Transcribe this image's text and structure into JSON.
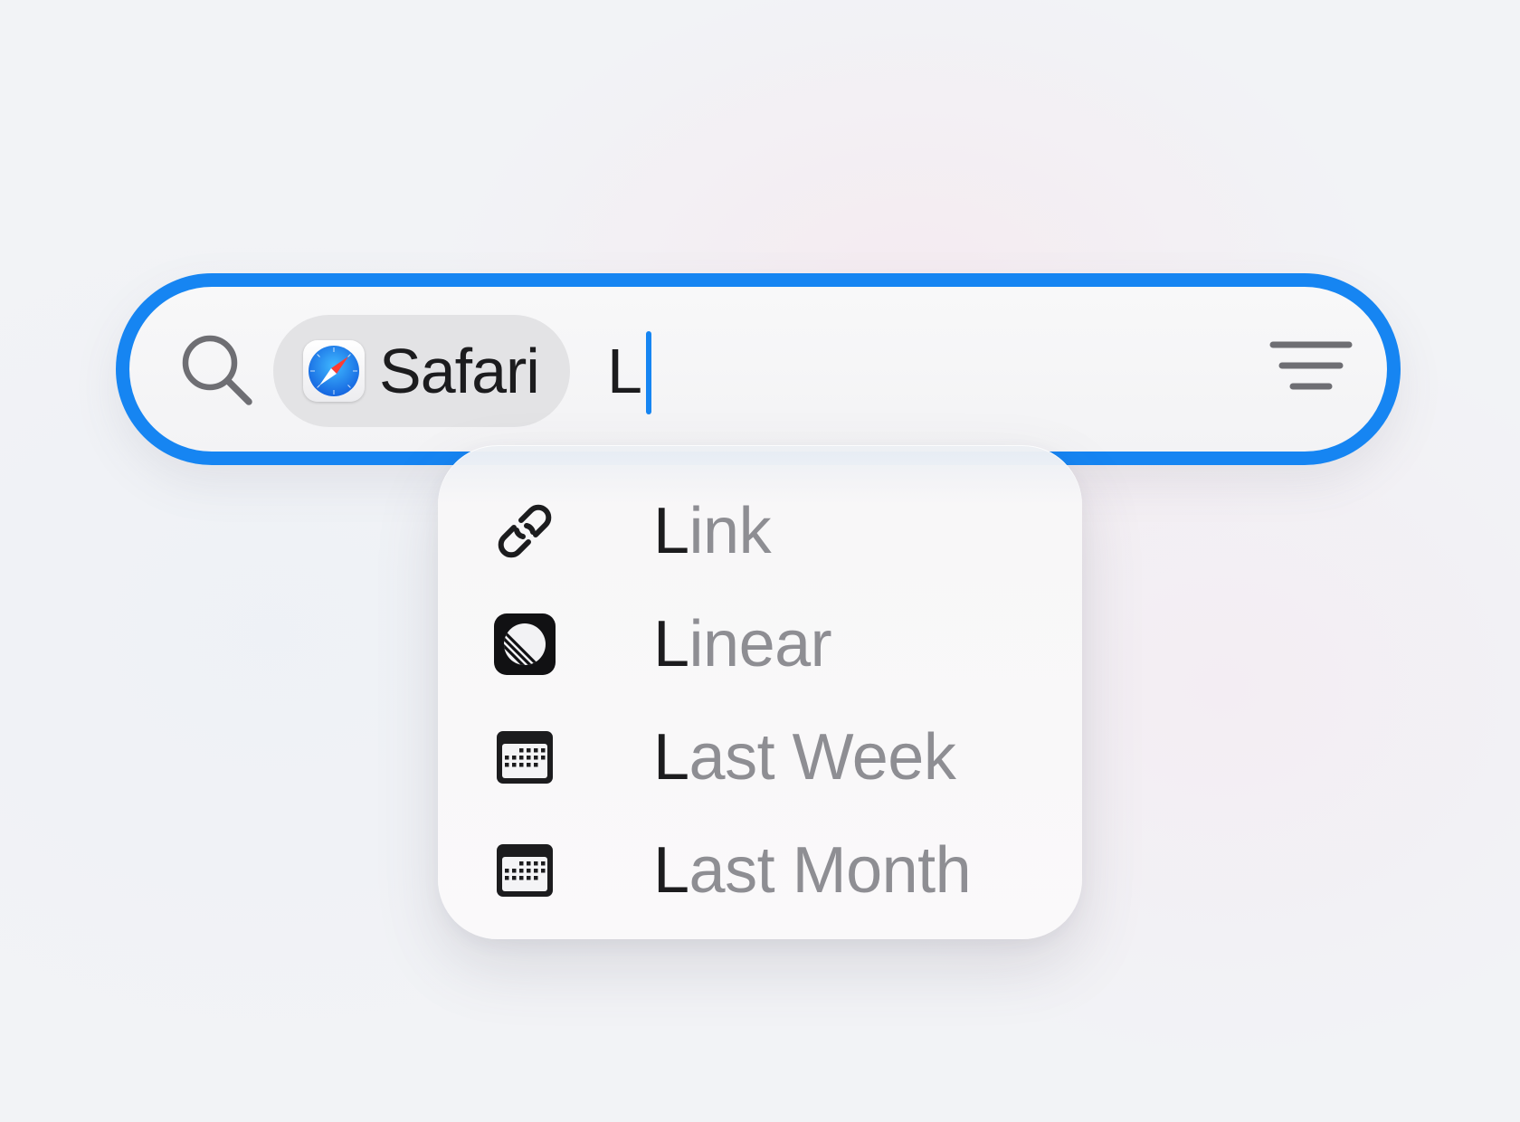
{
  "search": {
    "scope_label": "Safari",
    "query": "L",
    "accent_color": "#1685f2"
  },
  "icons": {
    "search": "magnifying-glass",
    "scope": "safari-compass",
    "filter": "filter-lines"
  },
  "suggestions": [
    {
      "match": "L",
      "rest": "ink",
      "icon": "link-icon"
    },
    {
      "match": "L",
      "rest": "inear",
      "icon": "linear-app-icon"
    },
    {
      "match": "L",
      "rest": "ast Week",
      "icon": "calendar-icon"
    },
    {
      "match": "L",
      "rest": "ast Month",
      "icon": "calendar-icon"
    }
  ],
  "colors": {
    "matched_text": "#1c1c1e",
    "unmatched_text": "#8e8e93"
  }
}
